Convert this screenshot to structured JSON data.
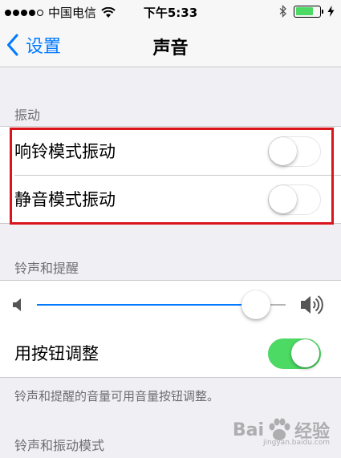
{
  "status_bar": {
    "carrier": "中国电信",
    "time": "下午5:33"
  },
  "nav": {
    "back_label": "设置",
    "title": "声音"
  },
  "vibration": {
    "header": "振动",
    "items": [
      {
        "label": "响铃模式振动",
        "on": false
      },
      {
        "label": "静音模式振动",
        "on": false
      }
    ]
  },
  "ringer": {
    "header": "铃声和提醒",
    "volume_level": 0.88,
    "buttons_toggle": {
      "label": "用按钮调整",
      "on": true
    },
    "note": "铃声和提醒的音量可用音量按钮调整。"
  },
  "pattern": {
    "header": "铃声和振动模式"
  },
  "watermark": {
    "text_left": "Bai",
    "text_right": "经验",
    "url": "jingyan.baidu.com"
  },
  "colors": {
    "accent": "#007aff",
    "switch_on": "#4cd964",
    "highlight": "#d9141b",
    "background": "#efeff4"
  }
}
